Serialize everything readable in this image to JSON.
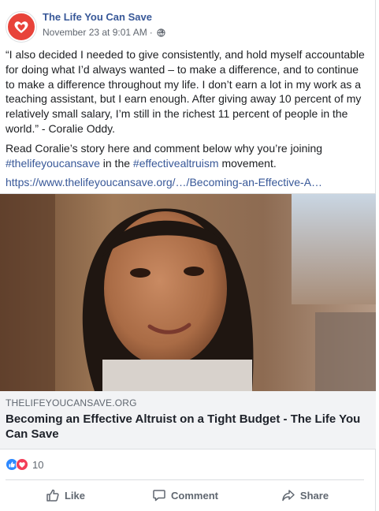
{
  "post": {
    "page_name": "The Life You Can Save",
    "timestamp": "November 23 at 9:01 AM",
    "separator": "·",
    "privacy_icon": "globe-icon",
    "quote": "“I also decided I needed to give consistently, and hold myself accountable for doing what I’d always wanted – to make a difference, and to continue to make a difference throughout my life. I don’t earn a lot in my work as a teaching assistant, but I earn enough. After giving away 10 percent of my relatively small salary, I’m still in the richest 11 percent of people in the world.” - Coralie Oddy.",
    "cta_prefix": "Read Coralie’s story here and comment below why you’re joining ",
    "hashtag1": "#thelifeyoucansave",
    "cta_middle": " in the ",
    "hashtag2": "#effectivealtruism",
    "cta_suffix": " movement.",
    "link_text": "https://www.thelifeyoucansave.org/…/Becoming-an-Effective-A…"
  },
  "link_card": {
    "domain": "THELIFEYOUCANSAVE.ORG",
    "title": "Becoming an Effective Altruist on a Tight Budget - The Life You Can Save"
  },
  "reactions": {
    "icons": [
      "like-reaction-icon",
      "love-reaction-icon"
    ],
    "count": "10"
  },
  "actions": {
    "like": "Like",
    "comment": "Comment",
    "share": "Share"
  },
  "colors": {
    "link": "#385898",
    "brand_red": "#e8433a",
    "like_blue": "#2d88ff",
    "love_red": "#f33e58",
    "muted": "#606770"
  }
}
